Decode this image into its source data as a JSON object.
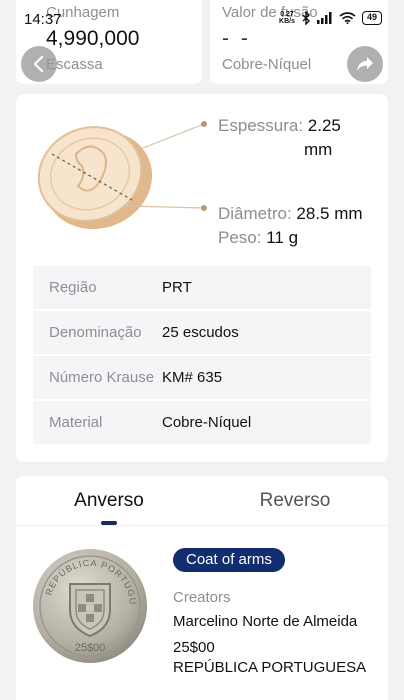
{
  "status_bar": {
    "time": "14:37",
    "net_speed_value": "0.27",
    "net_speed_unit": "KB/s",
    "battery": "49"
  },
  "mintage": {
    "label": "Cunhagem",
    "value": "4,990,000",
    "rarity": "Escassa"
  },
  "melt_value": {
    "label": "Valor de fusão",
    "value": "- -",
    "composition": "Cobre-Níquel"
  },
  "dimensions": {
    "thickness_label": "Espessura:",
    "thickness_value": "2.25",
    "thickness_unit": "mm",
    "diameter_label": "Diâmetro:",
    "diameter_value": "28.5 mm",
    "weight_label": "Peso:",
    "weight_value": "11 g"
  },
  "specs": [
    {
      "label": "Região",
      "value": "PRT"
    },
    {
      "label": "Denominação",
      "value": "25 escudos"
    },
    {
      "label": "Número Krause",
      "value": "KM# 635"
    },
    {
      "label": "Material",
      "value": "Cobre-Níquel"
    }
  ],
  "tabs": {
    "obverse": "Anverso",
    "reverse": "Reverso"
  },
  "side": {
    "tag": "Coat of arms",
    "creators_label": "Creators",
    "creator": "Marcelino Norte de Almeida",
    "legend_line1": "25$00",
    "legend_line2": "REPÚBLICA PORTUGUESA"
  },
  "colors": {
    "accent": "#132e6e",
    "coin_gold": "#e8c9a3",
    "coin_silver": "#b8b4a8"
  }
}
